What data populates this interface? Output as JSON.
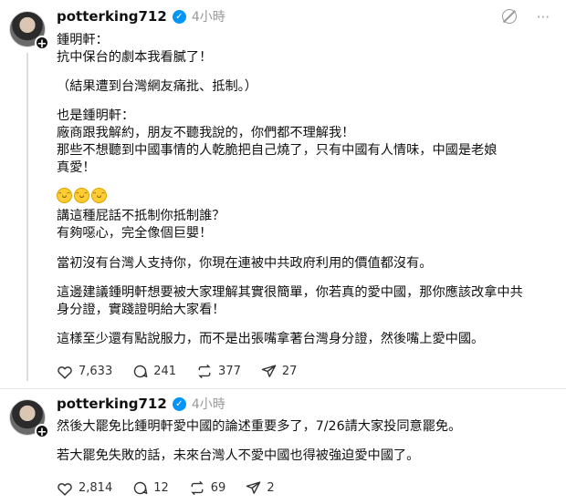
{
  "post1": {
    "username": "potterking712",
    "time": "4小時",
    "lines": [
      "鍾明軒：",
      "抗中保台的劇本我看膩了！",
      "（結果遭到台灣網友痛批、抵制。）",
      "也是鍾明軒：",
      "廠商跟我解約，朋友不聽我說的，你們都不理解我！",
      "那些不想聽到中國事情的人乾脆把自己燒了，只有中國有人情味，中國是老娘",
      "真愛！",
      "講這種屁話不抵制你抵制誰？",
      "有夠噁心，完全像個巨嬰！",
      "當初沒有台灣人支持你，你現在連被中共政府利用的價值都沒有。",
      "這邊建議鍾明軒想要被大家理解其實很簡單，你若真的愛中國，那你應該改拿中共",
      "身分證，實踐證明給大家看！",
      "這樣至少還有點說服力，而不是出張嘴拿著台灣身分證，然後嘴上愛中國。"
    ],
    "likes": "7,633",
    "comments": "241",
    "reposts": "377",
    "shares": "27"
  },
  "post2": {
    "username": "potterking712",
    "time": "4小時",
    "lines": [
      "然後大罷免比鍾明軒愛中國的論述重要多了，7/26請大家投同意罷免。",
      "若大罷免失敗的話，未來台灣人不愛中國也得被強迫愛中國了。"
    ],
    "likes": "2,814",
    "comments": "12",
    "reposts": "69",
    "shares": "2"
  },
  "icons": {
    "verified": "verified-badge-icon",
    "follow": "plus-icon",
    "menu": "more-icon",
    "blocked": "circle-slash-icon",
    "like": "heart-icon",
    "comment": "comment-icon",
    "repost": "repost-icon",
    "share": "send-icon",
    "emoji": "grinning-face-icon"
  },
  "colors": {
    "verified": "#0095f6",
    "muted": "#999999",
    "text": "#111111"
  }
}
